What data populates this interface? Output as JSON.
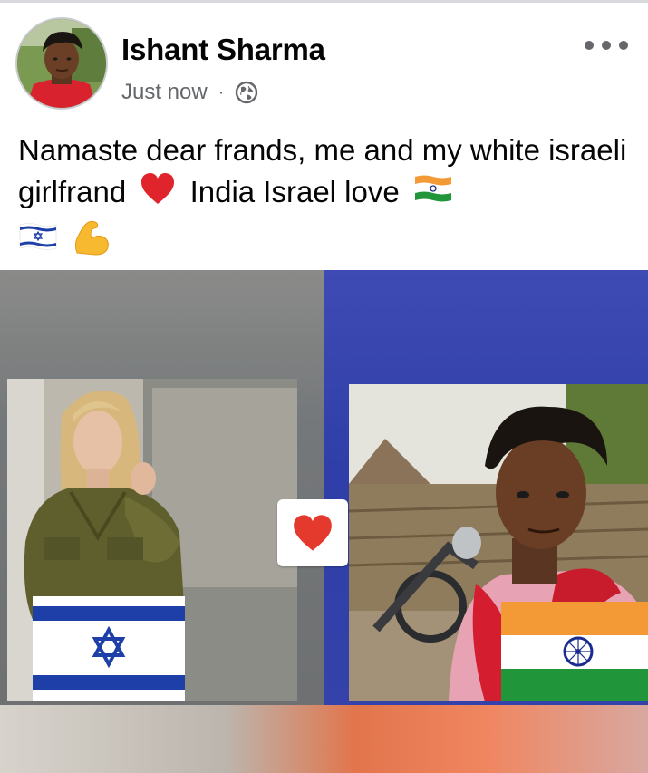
{
  "post": {
    "author": "Ishant Sharma",
    "timestamp": "Just now",
    "separator": "·",
    "privacy_icon": "globe-icon",
    "more_icon": "more-horizontal-icon",
    "caption_text": "Namaste dear frands, me and my white israeli girlfrand",
    "caption_text_2": "India Israel love",
    "caption_emojis": [
      "red-heart-emoji",
      "india-flag-emoji",
      "israel-flag-emoji",
      "flexed-biceps-emoji"
    ]
  },
  "photo": {
    "left_flag": "israel-flag",
    "right_flag": "india-flag",
    "center_icon": "red-heart-icon"
  },
  "colors": {
    "name": "#050505",
    "meta": "#65676b",
    "israel_blue": "#1f3fa8",
    "india_saffron": "#f39a37",
    "india_green": "#20953a",
    "chakra": "#1c2b8f",
    "heart": "#e43a2e"
  }
}
